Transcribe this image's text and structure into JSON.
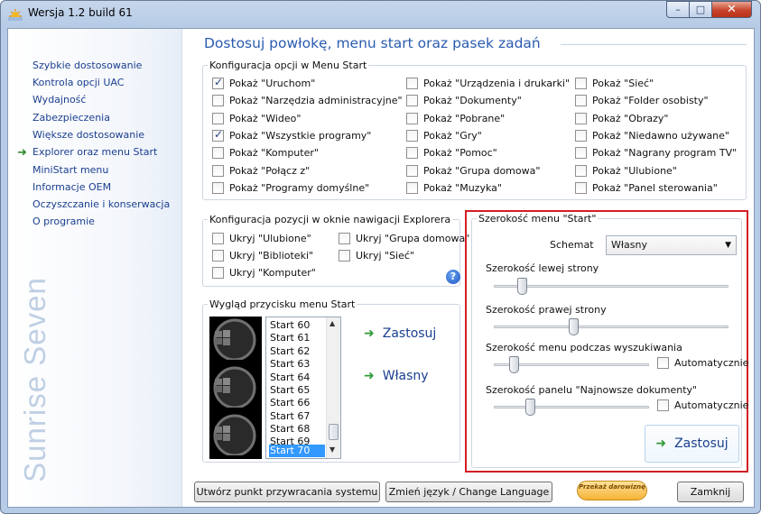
{
  "window": {
    "title": "Wersja 1.2 build 61",
    "min": "–",
    "max": "□",
    "close": "✕"
  },
  "sidebar": {
    "items": [
      {
        "label": "Szybkie dostosowanie"
      },
      {
        "label": "Kontrola opcji UAC"
      },
      {
        "label": "Wydajność"
      },
      {
        "label": "Zabezpieczenia"
      },
      {
        "label": "Większe dostosowanie"
      },
      {
        "label": "Explorer oraz menu Start",
        "active": true
      },
      {
        "label": "MiniStart menu"
      },
      {
        "label": "Informacje OEM"
      },
      {
        "label": "Oczyszczanie i konserwacja"
      },
      {
        "label": "O programie"
      }
    ],
    "brand": "Sunrise Seven"
  },
  "main": {
    "heading": "Dostosuj powłokę, menu start oraz pasek zadań",
    "start_menu_group": {
      "title": "Konfiguracja opcji w Menu Start",
      "col1": [
        {
          "label": "Pokaż \"Uruchom\"",
          "checked": true
        },
        {
          "label": "Pokaż \"Narzędzia administracyjne\"",
          "checked": false
        },
        {
          "label": "Pokaż \"Wideo\"",
          "checked": false
        },
        {
          "label": "Pokaż \"Wszystkie programy\"",
          "checked": true
        },
        {
          "label": "Pokaż \"Komputer\"",
          "checked": false
        },
        {
          "label": "Pokaż \"Połącz z\"",
          "checked": false
        },
        {
          "label": "Pokaż \"Programy domyślne\"",
          "checked": false
        }
      ],
      "col2": [
        {
          "label": "Pokaż \"Urządzenia i drukarki\"",
          "checked": false
        },
        {
          "label": "Pokaż \"Dokumenty\"",
          "checked": false
        },
        {
          "label": "Pokaż \"Pobrane\"",
          "checked": false
        },
        {
          "label": "Pokaż \"Gry\"",
          "checked": false
        },
        {
          "label": "Pokaż \"Pomoc\"",
          "checked": false
        },
        {
          "label": "Pokaż \"Grupa domowa\"",
          "checked": false
        },
        {
          "label": "Pokaż \"Muzyka\"",
          "checked": false
        }
      ],
      "col3": [
        {
          "label": "Pokaż \"Sieć\"",
          "checked": false
        },
        {
          "label": "Pokaż \"Folder osobisty\"",
          "checked": false
        },
        {
          "label": "Pokaż \"Obrazy\"",
          "checked": false
        },
        {
          "label": "Pokaż \"Niedawno używane\"",
          "checked": false
        },
        {
          "label": "Pokaż \"Nagrany program TV\"",
          "checked": false
        },
        {
          "label": "Pokaż \"Ulubione\"",
          "checked": false
        },
        {
          "label": "Pokaż \"Panel sterowania\"",
          "checked": false
        }
      ]
    },
    "explorer_group": {
      "title": "Konfiguracja pozycji w oknie nawigacji Explorera",
      "items": [
        {
          "label": "Ukryj \"Ulubione\"",
          "checked": false
        },
        {
          "label": "Ukryj \"Grupa domowa\"",
          "checked": false
        },
        {
          "label": "Ukryj \"Biblioteki\"",
          "checked": false
        },
        {
          "label": "Ukryj  \"Sieć\"",
          "checked": false
        },
        {
          "label": "Ukryj \"Komputer\"",
          "checked": false
        }
      ],
      "help": "?"
    },
    "start_button_group": {
      "title": "Wygląd przycisku menu Start",
      "list": [
        "Start 60",
        "Start 61",
        "Start 62",
        "Start 63",
        "Start 64",
        "Start 65",
        "Start 66",
        "Start 67",
        "Start 68",
        "Start 69",
        "Start 70"
      ],
      "selected": "Start 70",
      "apply_label": "Zastosuj",
      "custom_label": "Własny"
    },
    "width_group": {
      "title": "Szerokość menu \"Start\"",
      "scheme_label": "Schemat",
      "scheme_value": "Własny",
      "left_label": "Szerokość lewej strony",
      "right_label": "Szerokość prawej strony",
      "search_label": "Szerokość menu podczas wyszukiwania",
      "recent_label": "Szerokość panelu \"Najnowsze dokumenty\"",
      "auto_label": "Automatycznie",
      "apply_label": "Zastosuj",
      "left_value": 0.12,
      "right_value": 0.34,
      "search_value": 0.13,
      "recent_value": 0.23
    }
  },
  "footer": {
    "restore": "Utwórz punkt przywracania systemu",
    "language": "Zmień język / Change Language",
    "donate": "Przekaż darowiznę",
    "close": "Zamknij"
  }
}
